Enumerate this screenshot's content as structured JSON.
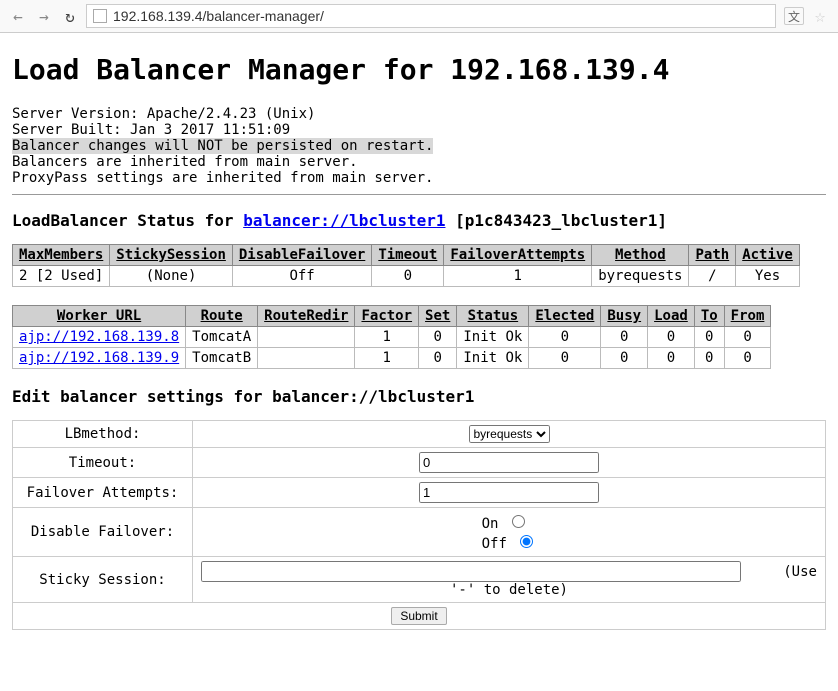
{
  "browser": {
    "url": "192.168.139.4/balancer-manager/"
  },
  "header": {
    "title": "Load Balancer Manager for 192.168.139.4"
  },
  "server_info": {
    "version": "Server Version: Apache/2.4.23 (Unix)",
    "built": "Server Built: Jan 3 2017 11:51:09",
    "warn": "Balancer changes will NOT be persisted on restart.",
    "inherit1": "Balancers are inherited from main server.",
    "inherit2": "ProxyPass settings are inherited from main server."
  },
  "status_heading": {
    "prefix": "LoadBalancer Status for ",
    "link": "balancer://lbcluster1",
    "suffix": " [p1c843423_lbcluster1]"
  },
  "balancer_table": {
    "headers": [
      "MaxMembers",
      "StickySession",
      "DisableFailover",
      "Timeout",
      "FailoverAttempts",
      "Method",
      "Path",
      "Active"
    ],
    "row": {
      "max": "2 [2 Used]",
      "sticky": "(None)",
      "disable": "Off",
      "timeout": "0",
      "failover": "1",
      "method": "byrequests",
      "path": "/",
      "active": "Yes"
    }
  },
  "worker_table": {
    "headers": [
      "Worker URL",
      "Route",
      "RouteRedir",
      "Factor",
      "Set",
      "Status",
      "Elected",
      "Busy",
      "Load",
      "To",
      "From"
    ],
    "rows": [
      {
        "url": "ajp://192.168.139.8",
        "route": "TomcatA",
        "redir": "",
        "factor": "1",
        "set": "0",
        "status": "Init Ok",
        "elected": "0",
        "busy": "0",
        "load": "0",
        "to": "0",
        "from": "0"
      },
      {
        "url": "ajp://192.168.139.9",
        "route": "TomcatB",
        "redir": "",
        "factor": "1",
        "set": "0",
        "status": "Init Ok",
        "elected": "0",
        "busy": "0",
        "load": "0",
        "to": "0",
        "from": "0"
      }
    ]
  },
  "form_heading": "Edit balancer settings for balancer://lbcluster1",
  "form": {
    "lbmethod_label": "LBmethod:",
    "lbmethod_value": "byrequests",
    "timeout_label": "Timeout:",
    "timeout_value": "0",
    "failover_label": "Failover Attempts:",
    "failover_value": "1",
    "disable_label": "Disable Failover:",
    "disable_on": "On",
    "disable_off": "Off",
    "sticky_label": "Sticky Session:",
    "sticky_hint": "(Use '-' to delete)",
    "submit_label": "Submit"
  }
}
